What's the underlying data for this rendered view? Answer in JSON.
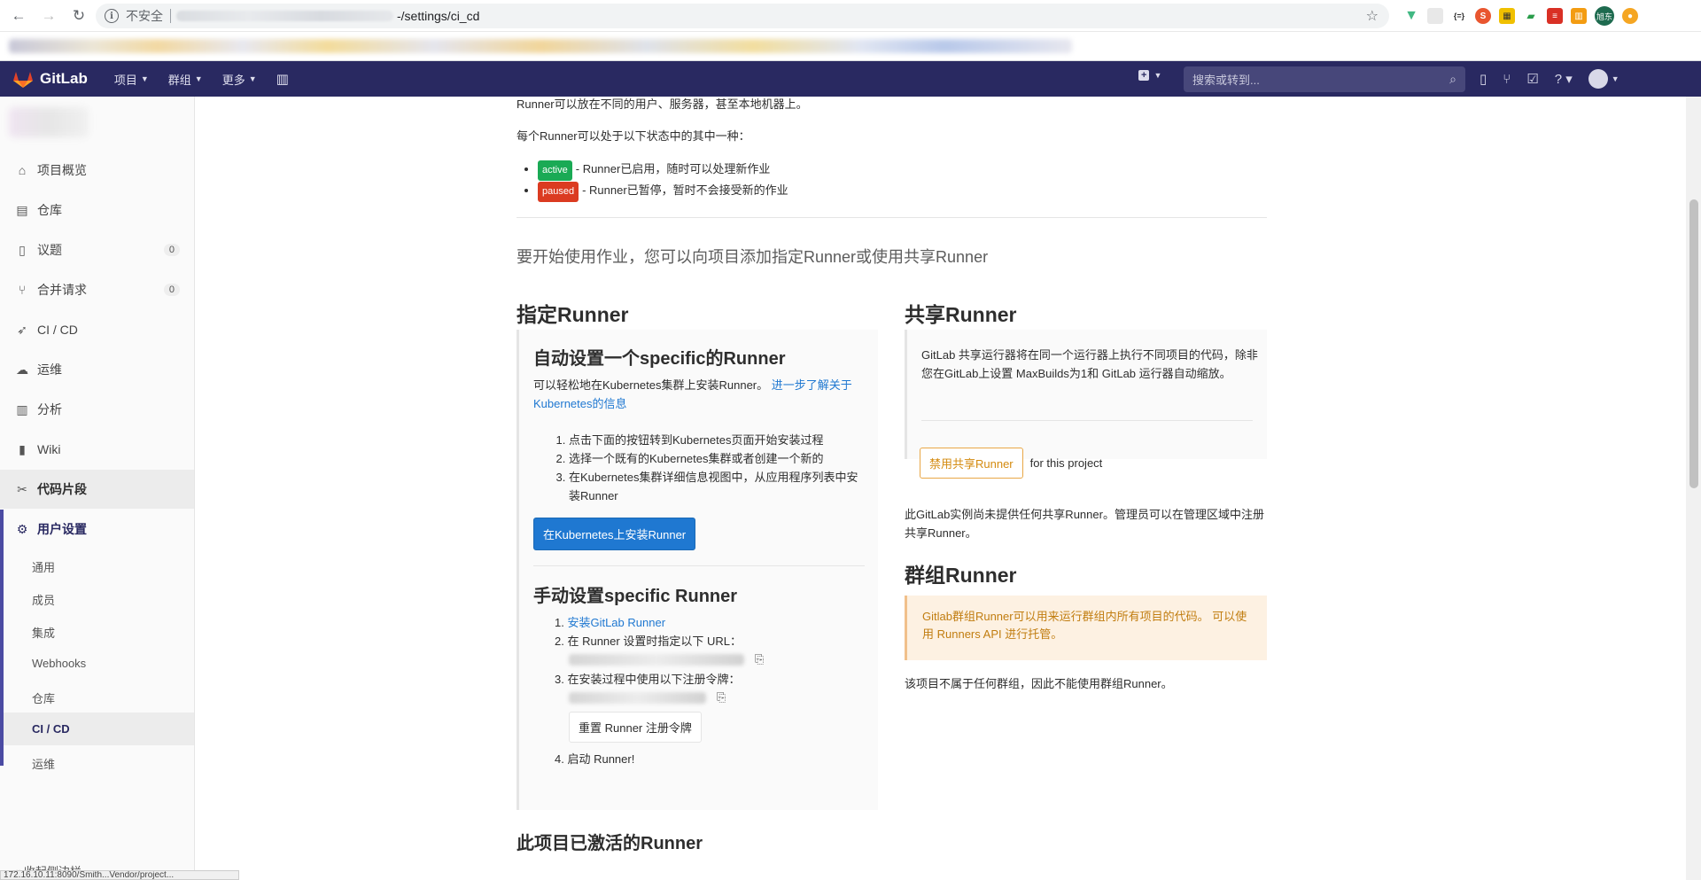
{
  "browser": {
    "insecure_label": "不安全",
    "url_path": "-/settings/ci_cd",
    "avatar_text": "旭东"
  },
  "header": {
    "brand": "GitLab",
    "menu": [
      {
        "label": "项目"
      },
      {
        "label": "群组"
      },
      {
        "label": "更多"
      }
    ],
    "search_placeholder": "搜索或转到..."
  },
  "sidebar": {
    "items": [
      {
        "label": "项目概览",
        "icon": "home-icon"
      },
      {
        "label": "仓库",
        "icon": "doc-icon"
      },
      {
        "label": "议题",
        "icon": "issues-icon",
        "count": "0"
      },
      {
        "label": "合并请求",
        "icon": "merge-icon",
        "count": "0"
      },
      {
        "label": "CI / CD",
        "icon": "rocket-icon"
      },
      {
        "label": "运维",
        "icon": "cloud-icon"
      },
      {
        "label": "分析",
        "icon": "chart-icon"
      },
      {
        "label": "Wiki",
        "icon": "book-icon"
      },
      {
        "label": "代码片段",
        "icon": "scissors-icon"
      },
      {
        "label": "用户设置",
        "icon": "gear-icon"
      }
    ],
    "sub_items": [
      {
        "label": "通用"
      },
      {
        "label": "成员"
      },
      {
        "label": "集成"
      },
      {
        "label": "Webhooks"
      },
      {
        "label": "仓库"
      },
      {
        "label": "CI / CD"
      },
      {
        "label": "运维"
      }
    ],
    "collapse_label": "收起侧边栏",
    "status_url": "172.16.10.11:8090/Smith...Vendor/project..."
  },
  "main": {
    "intro": "Runner可以放在不同的用户、服务器，甚至本地机器上。",
    "states_intro": "每个Runner可以处于以下状态中的其中一种：",
    "states": [
      {
        "badge": "active",
        "text": "- Runner已启用，随时可以处理新作业"
      },
      {
        "badge": "paused",
        "text": "- Runner已暂停，暂时不会接受新的作业"
      }
    ],
    "lead": "要开始使用作业，您可以向项目添加指定Runner或使用共享Runner",
    "specific": {
      "title": "指定Runner",
      "auto_title": "自动设置一个specific的Runner",
      "auto_desc": "可以轻松地在Kubernetes集群上安装Runner。",
      "auto_link": "进一步了解关于Kubernetes的信息",
      "auto_steps": [
        "点击下面的按钮转到Kubernetes页面开始安装过程",
        "选择一个既有的Kubernetes集群或者创建一个新的",
        "在Kubernetes集群详细信息视图中，从应用程序列表中安装Runner"
      ],
      "install_button": "在Kubernetes上安装Runner",
      "manual_title": "手动设置specific Runner",
      "install_link": "安装GitLab Runner",
      "step2": "在 Runner 设置时指定以下 URL：",
      "step3": "在安装过程中使用以下注册令牌：",
      "reset_button": "重置 Runner 注册令牌",
      "step4": "启动 Runner!"
    },
    "shared": {
      "title": "共享Runner",
      "desc": "GitLab 共享运行器将在同一个运行器上执行不同项目的代码，除非您在GitLab上设置 MaxBuilds为1和 GitLab 运行器自动缩放。",
      "disable_button": "禁用共享Runner",
      "for_project": "for this project",
      "none_text": "此GitLab实例尚未提供任何共享Runner。管理员可以在管理区域中注册共享Runner。"
    },
    "group": {
      "title": "群组Runner",
      "warning": "Gitlab群组Runner可以用来运行群组内所有项目的代码。 可以使用 Runners API 进行托管。",
      "none_text": "该项目不属于任何群组，因此不能使用群组Runner。"
    },
    "activated_title": "此项目已激活的Runner"
  },
  "colors": {
    "header_bg": "#292961",
    "active_badge": "#1aaa55",
    "paused_badge": "#db3b21",
    "primary_button": "#1f78d1",
    "warning_bg": "#fdf1e2"
  }
}
